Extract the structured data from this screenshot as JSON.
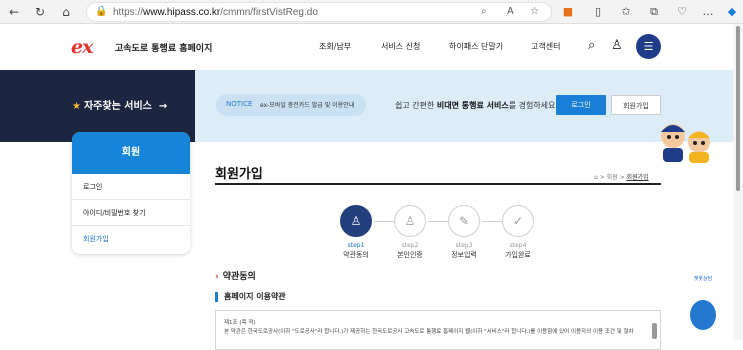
{
  "browser": {
    "url_prefix": "https://",
    "url_host": "www.hipass.co.kr",
    "url_path": "/cmmn/firstVistReg.do"
  },
  "header": {
    "logo_mark": "ex",
    "logo_text": "고속도로 통행료 홈페이지",
    "nav": [
      "조회/납부",
      "서비스 신청",
      "하이패스 단말기",
      "고객센터"
    ]
  },
  "hero": {
    "favorites": "자주찾는 서비스",
    "notice_tag": "NOTICE",
    "notice_text": "ex-모바일 충전카드 발급 및 이용안내",
    "message_pre": "쉽고 간편한 ",
    "message_bold": "비대면 통행료 서비스",
    "message_post": "를 경험하세요",
    "login_label": "로그인",
    "join_label": "회원가입"
  },
  "side": {
    "title": "회원",
    "items": [
      {
        "label": "로그인"
      },
      {
        "label": "아이디/비밀번호 찾기"
      },
      {
        "label": "회원가입"
      }
    ]
  },
  "main": {
    "title": "회원가입",
    "breadcrumb": [
      "회원",
      "회원가입"
    ],
    "steps": [
      {
        "num": "step1",
        "label": "약관동의",
        "icon": "user-check-icon"
      },
      {
        "num": "step2",
        "label": "본인인증",
        "icon": "user-verify-icon"
      },
      {
        "num": "step3",
        "label": "정보입력",
        "icon": "pencil-icon"
      },
      {
        "num": "step4",
        "label": "가입완료",
        "icon": "check-circle-icon"
      }
    ],
    "section_title": "약관동의",
    "sub_title": "홈페이지 이용약관",
    "terms_heading": "제1조 (목 적)",
    "terms_text": "본 약관은 한국도로공사(이하 \"도로공사\"라 합니다.)가 제공하는 한국도로공사 고속도로 통행료 홈페이지 웹(이하 \"서비스\"라 합니다.)를 이용함에 있어 이용자의 이용 조건 및 절차"
  },
  "float_widget": {
    "label": "챗봇상담"
  }
}
